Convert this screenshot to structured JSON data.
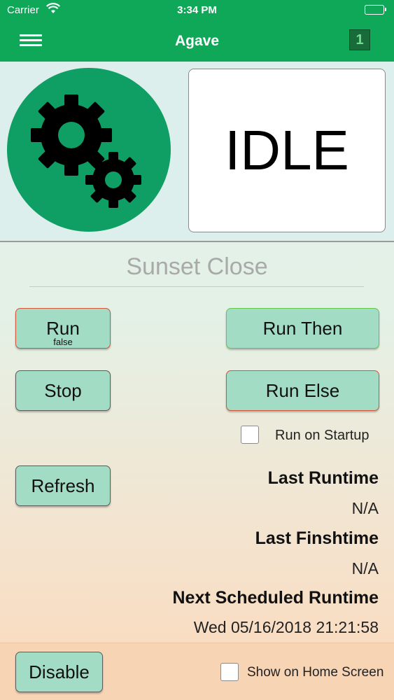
{
  "status_bar": {
    "carrier": "Carrier",
    "time": "3:34 PM",
    "wifi_icon": "wifi-icon",
    "battery_icon": "battery-icon"
  },
  "nav": {
    "title": "Agave",
    "menu_icon": "hamburger-menu-icon",
    "badge_count": "1",
    "color": "#0fa858"
  },
  "task": {
    "icon": "gears-icon",
    "state": "IDLE",
    "name": "Sunset Close"
  },
  "buttons": {
    "run": {
      "label": "Run",
      "sub": "false"
    },
    "run_then": "Run Then",
    "stop": "Stop",
    "run_else": "Run Else",
    "refresh": "Refresh",
    "disable": "Disable"
  },
  "options": {
    "run_on_startup": {
      "label": "Run on Startup",
      "checked": false
    },
    "show_on_home": {
      "label": "Show on Home Screen",
      "checked": false
    }
  },
  "runtimes": {
    "last_runtime_label": "Last Runtime",
    "last_runtime_value": "N/A",
    "last_finishtime_label": "Last Finshtime",
    "last_finishtime_value": "N/A",
    "next_scheduled_label": "Next Scheduled Runtime",
    "next_scheduled_value": "Wed 05/16/2018 21:21:58"
  }
}
